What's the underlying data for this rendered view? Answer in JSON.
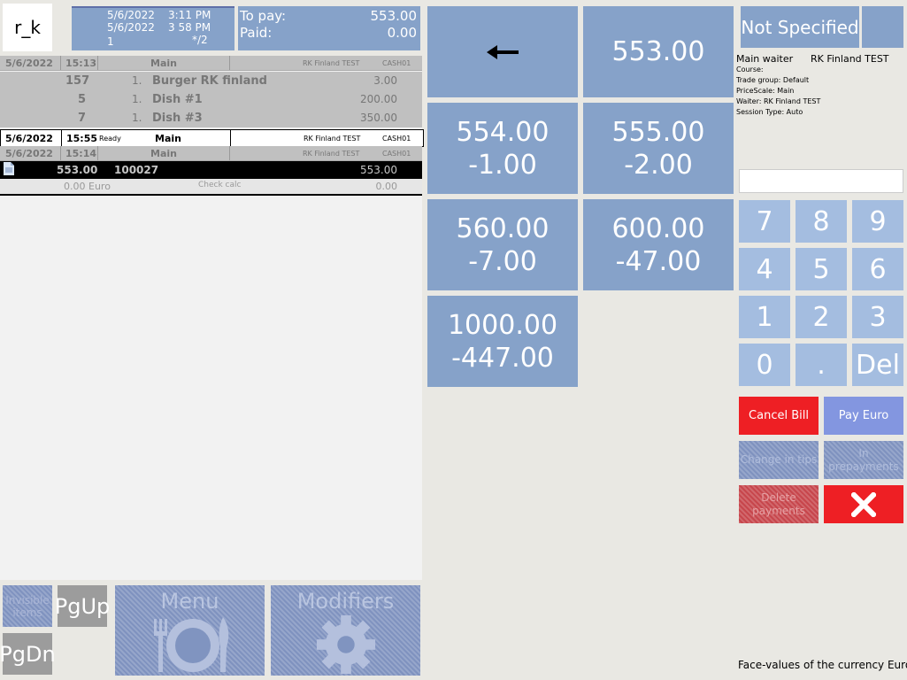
{
  "header": {
    "logo": "r_k",
    "date1": "5/6/2022",
    "time1": "3:11 PM",
    "date2": "5/6/2022",
    "time2": "3 58 PM",
    "guests": "1",
    "table": "*/2",
    "to_pay_label": "To pay:",
    "to_pay_value": "553.00",
    "paid_label": "Paid:",
    "paid_value": "0.00"
  },
  "orders": {
    "session1": {
      "date": "5/6/2022",
      "time": "15:13",
      "name": "Main",
      "waiter": "RK Finland TEST",
      "station": "CASH01"
    },
    "items": [
      {
        "code": "157",
        "qty": "1.",
        "name": "Burger RK finland",
        "price": "3.00"
      },
      {
        "code": "5",
        "qty": "1.",
        "name": "Dish #1",
        "price": "200.00"
      },
      {
        "code": "7",
        "qty": "1.",
        "name": "Dish #3",
        "price": "350.00"
      }
    ],
    "session2": {
      "date": "5/6/2022",
      "time": "15:55",
      "status": "Ready",
      "name": "Main",
      "waiter": "RK Finland TEST",
      "station": "CASH01"
    },
    "session3": {
      "date": "5/6/2022",
      "time": "15:14",
      "name": "Main",
      "waiter": "RK Finland TEST",
      "station": "CASH01"
    },
    "payment_row": {
      "amount": "553.00",
      "check": "100027",
      "total": "553.00"
    },
    "footer": {
      "currency": "0.00 Euro",
      "label": "Check calc",
      "value": "0.00"
    }
  },
  "bottom_buttons": {
    "invisible": "Invisible items",
    "pgup": "PgUp",
    "pgdn": "PgDn",
    "menu": "Menu",
    "modifiers": "Modifiers"
  },
  "amounts": [
    {
      "value": "553.00"
    },
    {
      "value": "554.00",
      "change": "-1.00"
    },
    {
      "value": "555.00",
      "change": "-2.00"
    },
    {
      "value": "560.00",
      "change": "-7.00"
    },
    {
      "value": "600.00",
      "change": "-47.00"
    },
    {
      "value": "1000.00",
      "change": "-447.00"
    }
  ],
  "right": {
    "not_specified": "Not Specified",
    "main_waiter_label": "Main waiter",
    "main_waiter_value": "RK Finland TEST",
    "course": "Course:",
    "trade_group": "Trade group: Default",
    "price_scale": "PriceScale: Main",
    "waiter": "Waiter: RK Finland TEST",
    "session_type": "Session Type: Auto"
  },
  "keypad": [
    "7",
    "8",
    "9",
    "4",
    "5",
    "6",
    "1",
    "2",
    "3",
    "0",
    ".",
    "Del"
  ],
  "actions": {
    "cancel_bill": "Cancel Bill",
    "pay_euro": "Pay Euro",
    "change_tips": "Change in tips",
    "prepayments": "In prepayments",
    "delete_payments": "Delete payments"
  },
  "face_values": "Face-values of the currency Euro",
  "colors": {
    "accent": "#86a2c9",
    "danger": "#ee1f24",
    "pay": "#8396e0"
  }
}
